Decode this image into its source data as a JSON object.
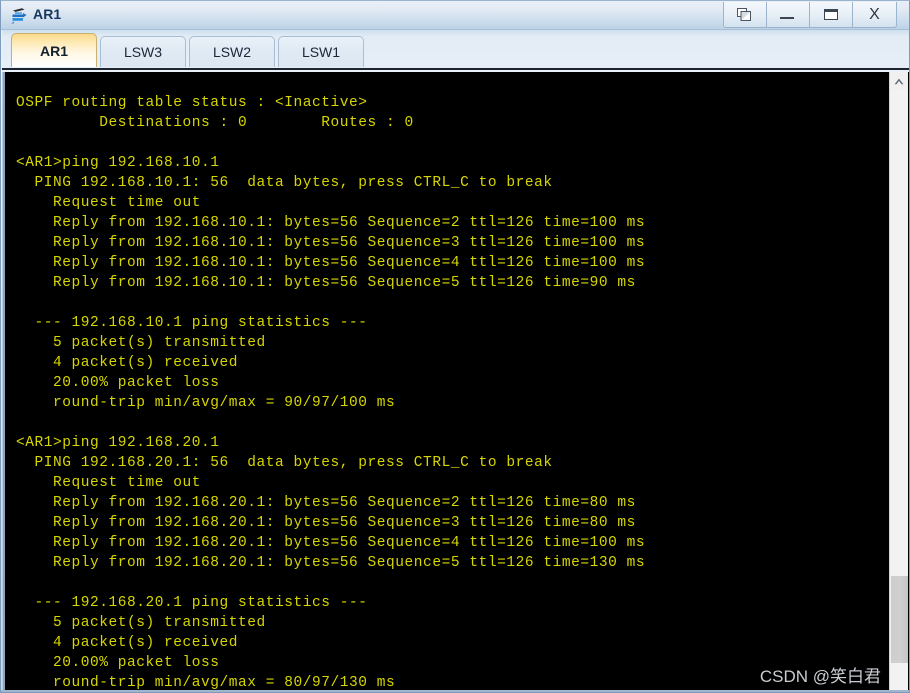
{
  "window": {
    "title": "AR1",
    "icon": "router-device-icon",
    "controls": [
      {
        "name": "restore-button",
        "icon": "restore-windows-icon",
        "label": ""
      },
      {
        "name": "minimize-button",
        "icon": "minimize-icon",
        "label": ""
      },
      {
        "name": "maximize-button",
        "icon": "maximize-icon",
        "label": ""
      },
      {
        "name": "close-button",
        "icon": "close-icon",
        "label": "X"
      }
    ]
  },
  "tabs": [
    {
      "label": "AR1",
      "active": true
    },
    {
      "label": "LSW3",
      "active": false
    },
    {
      "label": "LSW2",
      "active": false
    },
    {
      "label": "LSW1",
      "active": false
    }
  ],
  "colors": {
    "terminal_background": "#000000",
    "terminal_text": "#d6d600",
    "active_tab_accent": "#fbd98a",
    "title_text": "#17365d",
    "watermark": "#c9cdd2"
  },
  "scrollbar": {
    "up_arrow_icon": "chevron-up-icon",
    "thumb_position_percent": 82
  },
  "watermark": {
    "text": "CSDN @笑白君"
  },
  "terminal": {
    "prompt": "<AR1>",
    "lines": [
      "",
      "OSPF routing table status : <Inactive>",
      "         Destinations : 0        Routes : 0",
      "",
      "<AR1>ping 192.168.10.1",
      "  PING 192.168.10.1: 56  data bytes, press CTRL_C to break",
      "    Request time out",
      "    Reply from 192.168.10.1: bytes=56 Sequence=2 ttl=126 time=100 ms",
      "    Reply from 192.168.10.1: bytes=56 Sequence=3 ttl=126 time=100 ms",
      "    Reply from 192.168.10.1: bytes=56 Sequence=4 ttl=126 time=100 ms",
      "    Reply from 192.168.10.1: bytes=56 Sequence=5 ttl=126 time=90 ms",
      "",
      "  --- 192.168.10.1 ping statistics ---",
      "    5 packet(s) transmitted",
      "    4 packet(s) received",
      "    20.00% packet loss",
      "    round-trip min/avg/max = 90/97/100 ms",
      "",
      "<AR1>ping 192.168.20.1",
      "  PING 192.168.20.1: 56  data bytes, press CTRL_C to break",
      "    Request time out",
      "    Reply from 192.168.20.1: bytes=56 Sequence=2 ttl=126 time=80 ms",
      "    Reply from 192.168.20.1: bytes=56 Sequence=3 ttl=126 time=80 ms",
      "    Reply from 192.168.20.1: bytes=56 Sequence=4 ttl=126 time=100 ms",
      "    Reply from 192.168.20.1: bytes=56 Sequence=5 ttl=126 time=130 ms",
      "",
      "  --- 192.168.20.1 ping statistics ---",
      "    5 packet(s) transmitted",
      "    4 packet(s) received",
      "    20.00% packet loss",
      "    round-trip min/avg/max = 80/97/130 ms"
    ]
  }
}
